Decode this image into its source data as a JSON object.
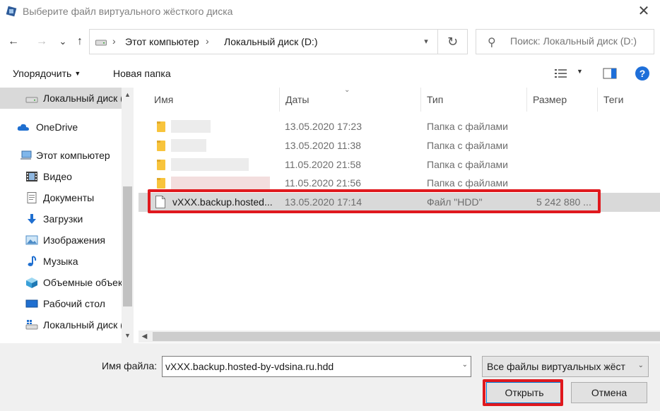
{
  "window": {
    "title": "Выберите файл виртуального жёсткого диска",
    "close_glyph": "✕"
  },
  "navigation": {
    "back_glyph": "←",
    "forward_glyph": "→",
    "recent_glyph": "⌄",
    "up_glyph": "↑",
    "breadcrumbs": [
      "Этот компьютер",
      "Локальный диск (D:)"
    ],
    "separator": "›",
    "refresh_glyph": "↻"
  },
  "search": {
    "placeholder": "Поиск: Локальный диск (D:)"
  },
  "toolbar": {
    "organize_label": "Упорядочить",
    "new_folder_label": "Новая папка",
    "help_label": "?"
  },
  "sidebar": {
    "items": [
      {
        "label": "Локальный диск (D:)",
        "icon": "drive-icon"
      },
      {
        "label": "OneDrive",
        "icon": "onedrive-cloud-icon"
      },
      {
        "label": "Этот компьютер",
        "icon": "computer-icon"
      },
      {
        "label": "Видео",
        "icon": "video-icon"
      },
      {
        "label": "Документы",
        "icon": "documents-icon"
      },
      {
        "label": "Загрузки",
        "icon": "downloads-icon"
      },
      {
        "label": "Изображения",
        "icon": "pictures-icon"
      },
      {
        "label": "Музыка",
        "icon": "music-icon"
      },
      {
        "label": "Объемные объекты",
        "icon": "3d-objects-icon"
      },
      {
        "label": "Рабочий стол",
        "icon": "desktop-icon"
      },
      {
        "label": "Локальный диск (C:)",
        "icon": "windows-drive-icon"
      }
    ]
  },
  "file_list": {
    "columns": [
      "Имя",
      "Даты",
      "Тип",
      "Размер",
      "Теги"
    ],
    "rows": [
      {
        "name": "",
        "date": "13.05.2020 17:23",
        "type": "Папка с файлами",
        "size": ""
      },
      {
        "name": "",
        "date": "13.05.2020 11:38",
        "type": "Папка с файлами",
        "size": ""
      },
      {
        "name": "",
        "date": "11.05.2020 21:58",
        "type": "Папка с файлами",
        "size": ""
      },
      {
        "name": "",
        "date": "11.05.2020 21:56",
        "type": "Папка с файлами",
        "size": ""
      },
      {
        "name": "vXXX.backup.hosted...",
        "date": "13.05.2020 17:14",
        "type": "Файл \"HDD\"",
        "size": "5 242 880 ..."
      }
    ]
  },
  "footer": {
    "filename_label": "Имя файла:",
    "filename_value": "vXXX.backup.hosted-by-vdsina.ru.hdd",
    "filetype_value": "Все файлы виртуальных жёстких дисков",
    "open_label": "Открыть",
    "cancel_label": "Отмена"
  },
  "colors": {
    "highlight_red": "#e0191e",
    "selection_gray": "#d9d9d9",
    "folder_yellow": "#f8c43c",
    "help_blue": "#1e6fd9"
  }
}
